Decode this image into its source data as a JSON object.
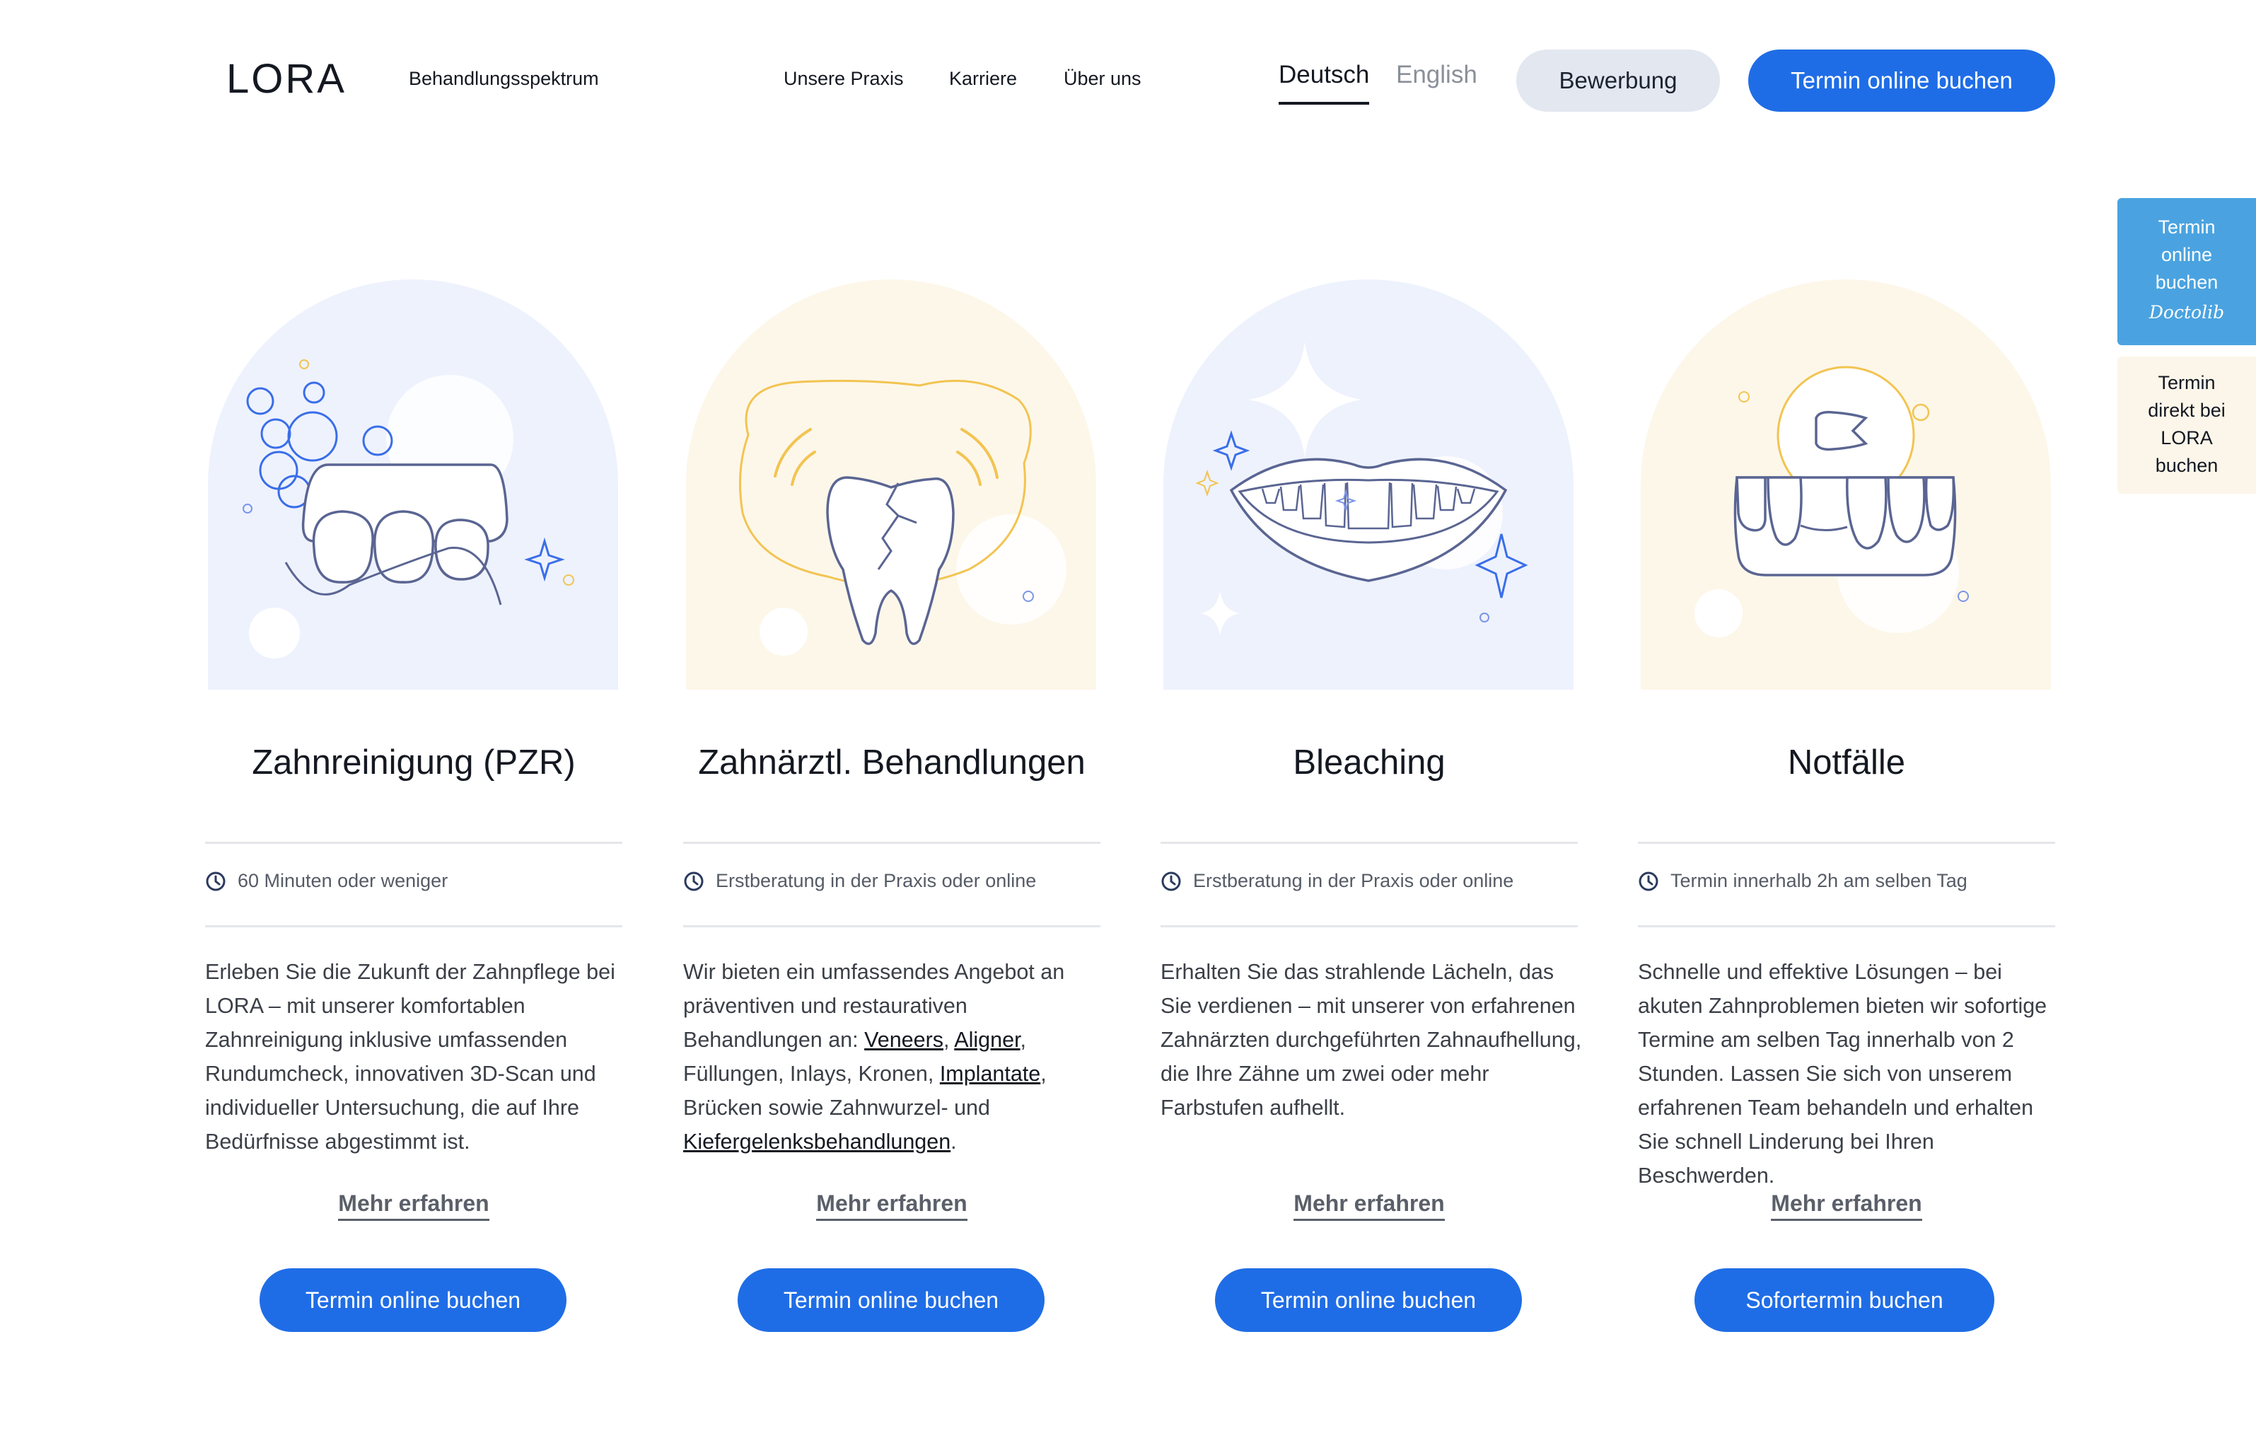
{
  "header": {
    "logo": "LORA",
    "nav": [
      "Behandlungsspektrum",
      "Unsere Praxis",
      "Karriere",
      "Über uns"
    ],
    "lang_de": "Deutsch",
    "lang_en": "English",
    "bewerbung_label": "Bewerbung",
    "cta_label": "Termin online buchen"
  },
  "side": {
    "doctolib_text": "Termin\nonline\nbuchen",
    "doctolib_brand": "Doctolib",
    "lora_text": "Termin\ndirekt bei\nLORA\nbuchen"
  },
  "colors": {
    "primary": "#1f6de6",
    "doctolib": "#4aa3e0",
    "arch_blue": "#eef2fd",
    "arch_yellow": "#fdf7ea"
  },
  "cards": [
    {
      "icon": "clock-icon",
      "illustration": "teeth-floss-illustration",
      "title": "Zahnreinigung (PZR)",
      "meta": "60 Minuten oder weniger",
      "desc": "Erleben Sie die Zukunft der Zahnpflege bei LORA – mit unserer komfortablen Zahnreinigung inklusive umfassenden Rundumcheck, innovativen 3D-Scan und individueller Untersuchung, die auf Ihre Bedürfnisse abgestimmt ist.",
      "more": "Mehr erfahren",
      "button": "Termin online buchen"
    },
    {
      "icon": "clock-icon",
      "illustration": "cracked-tooth-illustration",
      "title": "Zahnärztl. Behandlungen",
      "meta": "Erstberatung in der Praxis oder online",
      "desc_pre": "Wir bieten ein umfassendes Angebot an präventiven und restaurativen Behandlungen an: ",
      "link_veneers": "Veneers",
      "sep1": ", ",
      "link_aligner": "Aligner",
      "mid": ", Füllungen, Inlays, Kronen, ",
      "link_implantate": "Implantate",
      "mid2": ", Brücken sowie Zahnwurzel- und ",
      "link_kiefer": "Kiefergelenksbehandlungen",
      "end": ".",
      "more": "Mehr erfahren",
      "button": "Termin online buchen"
    },
    {
      "icon": "clock-icon",
      "illustration": "smile-illustration",
      "title": "Bleaching",
      "meta": "Erstberatung in der Praxis oder online",
      "desc": "Erhalten Sie das strahlende Lächeln, das Sie verdienen – mit unserer von erfahrenen Zahnärzten durchgeführten Zahnaufhellung, die Ihre Zähne um zwei oder mehr Farbstufen aufhellt.",
      "more": "Mehr erfahren",
      "button": "Termin online buchen"
    },
    {
      "icon": "clock-icon",
      "illustration": "broken-tooth-illustration",
      "title": "Notfälle",
      "meta": "Termin innerhalb 2h am selben Tag",
      "desc": "Schnelle und effektive Lösungen – bei akuten Zahnproblemen bieten wir sofortige Termine am selben Tag innerhalb von 2 Stunden. Lassen Sie sich von unserem erfahrenen Team behandeln und erhalten Sie schnell Linderung bei Ihren Beschwerden.",
      "more": "Mehr erfahren",
      "button": "Sofortermin buchen"
    }
  ]
}
